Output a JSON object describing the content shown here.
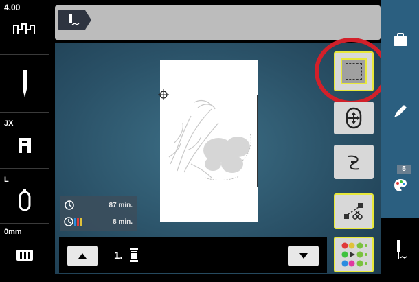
{
  "left_sidebar": {
    "stitch_length": "4.00",
    "foot_label": "JX",
    "hoop_label": "L",
    "offset_label": "0mm"
  },
  "time_panel": {
    "total_time": "87 min.",
    "color_time": "8 min."
  },
  "bottom_bar": {
    "color_index": "1."
  },
  "right_sidebar": {
    "palette_count": "5"
  },
  "icons": [
    "stitch-length-icon",
    "needle-icon",
    "presser-foot-icon",
    "hoop-icon",
    "feed-dog-icon",
    "stitch-tab-icon",
    "crosshair-icon",
    "clock-icon",
    "color-clock-icon",
    "thread-spool-icon",
    "arrow-up-icon",
    "arrow-down-icon",
    "check-frame-icon",
    "move-icon",
    "stitch-path-icon",
    "cut-jump-icon",
    "color-resequence-icon",
    "folder-icon",
    "pencil-icon",
    "palette-icon",
    "edit-stitch-icon"
  ],
  "colors": {
    "highlight": "#e8e83a",
    "callout": "#d2202a",
    "sidebar": "#2b5f80"
  }
}
